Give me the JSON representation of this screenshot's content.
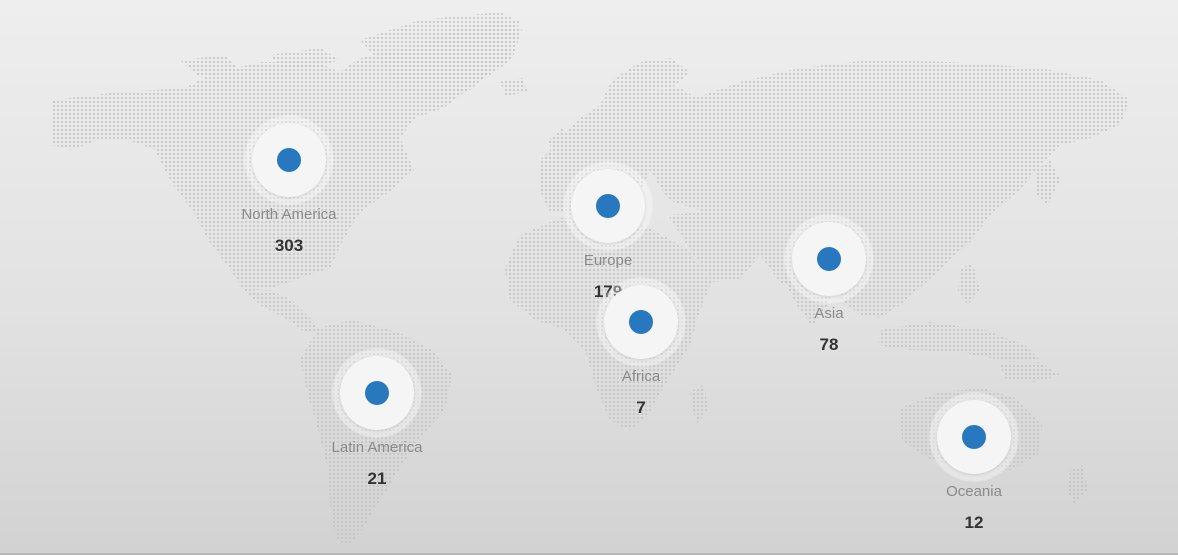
{
  "colors": {
    "marker_dot": "#2878c0",
    "land_dots": "#c4c4c4"
  },
  "map": {
    "icon": "world-map-icon"
  },
  "regions": [
    {
      "id": "north-america",
      "name": "North America",
      "count": "303"
    },
    {
      "id": "europe",
      "name": "Europe",
      "count": "179"
    },
    {
      "id": "asia",
      "name": "Asia",
      "count": "78"
    },
    {
      "id": "africa",
      "name": "Africa",
      "count": "7"
    },
    {
      "id": "latin-america",
      "name": "Latin America",
      "count": "21"
    },
    {
      "id": "oceania",
      "name": "Oceania",
      "count": "12"
    }
  ]
}
